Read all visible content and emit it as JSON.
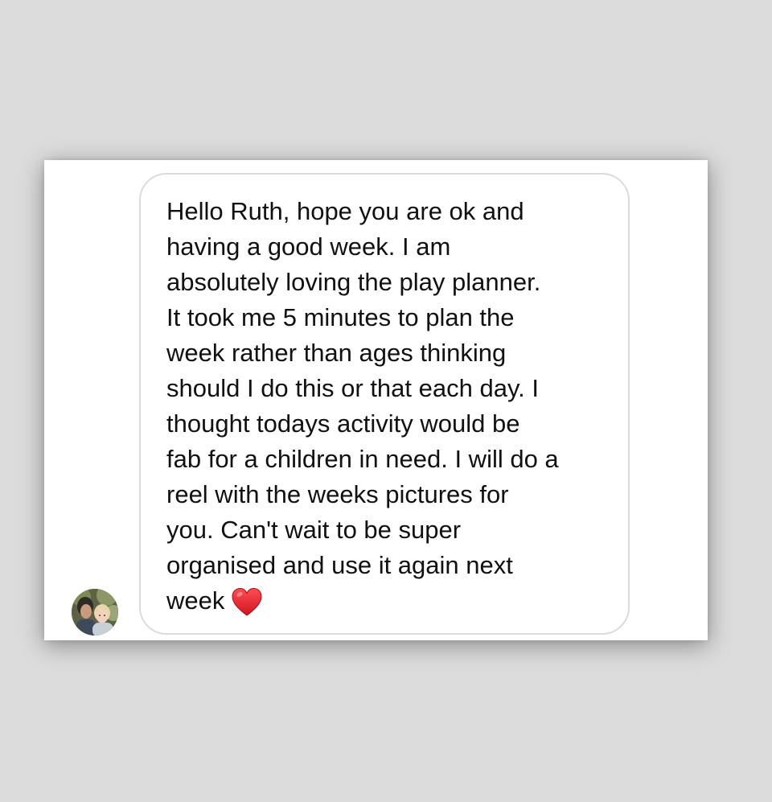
{
  "message": {
    "lines": [
      "Hello Ruth, hope you are ok and",
      "having a good week. I am",
      "absolutely loving the play planner.",
      "It took me 5 minutes to plan the",
      "week rather than ages thinking",
      "should I do this or that each day. I",
      "thought todays activity would be",
      "fab for a children in need. I will do a",
      "reel with the weeks pictures for",
      "you. Can't wait to be super",
      "organised and use it again next",
      "week"
    ],
    "trailing_emoji": "red-heart-icon"
  },
  "sender": {
    "avatar": "avatar-photo"
  },
  "colors": {
    "page_background": "#dcdcdc",
    "card_background": "#ffffff",
    "bubble_border": "#dbdbdb",
    "text": "#111111",
    "heart": "#e0242f"
  }
}
